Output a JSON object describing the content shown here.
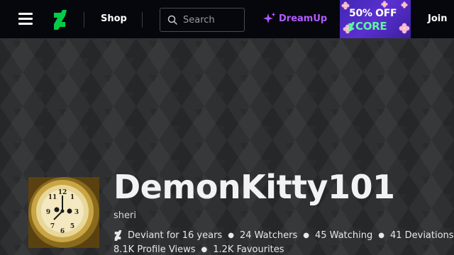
{
  "header": {
    "shop_label": "Shop",
    "search_placeholder": "Search",
    "dreamup_label": "DreamUp",
    "join_label": "Join",
    "promo": {
      "line1": "50% OFF",
      "line2": "CORE"
    }
  },
  "profile": {
    "username": "DemonKitty101",
    "real_name": "sheri",
    "deviant_for": "Deviant for 16 years",
    "watchers": "24 Watchers",
    "watching": "45 Watching",
    "deviations": "41 Deviations",
    "profile_views": "8.1K Profile Views",
    "favourites": "1.2K Favourites"
  },
  "colors": {
    "brand_green": "#05cc47",
    "dreamup_purple": "#b35cff",
    "topbar_bg": "#06070d",
    "page_bg": "#2f3032"
  }
}
